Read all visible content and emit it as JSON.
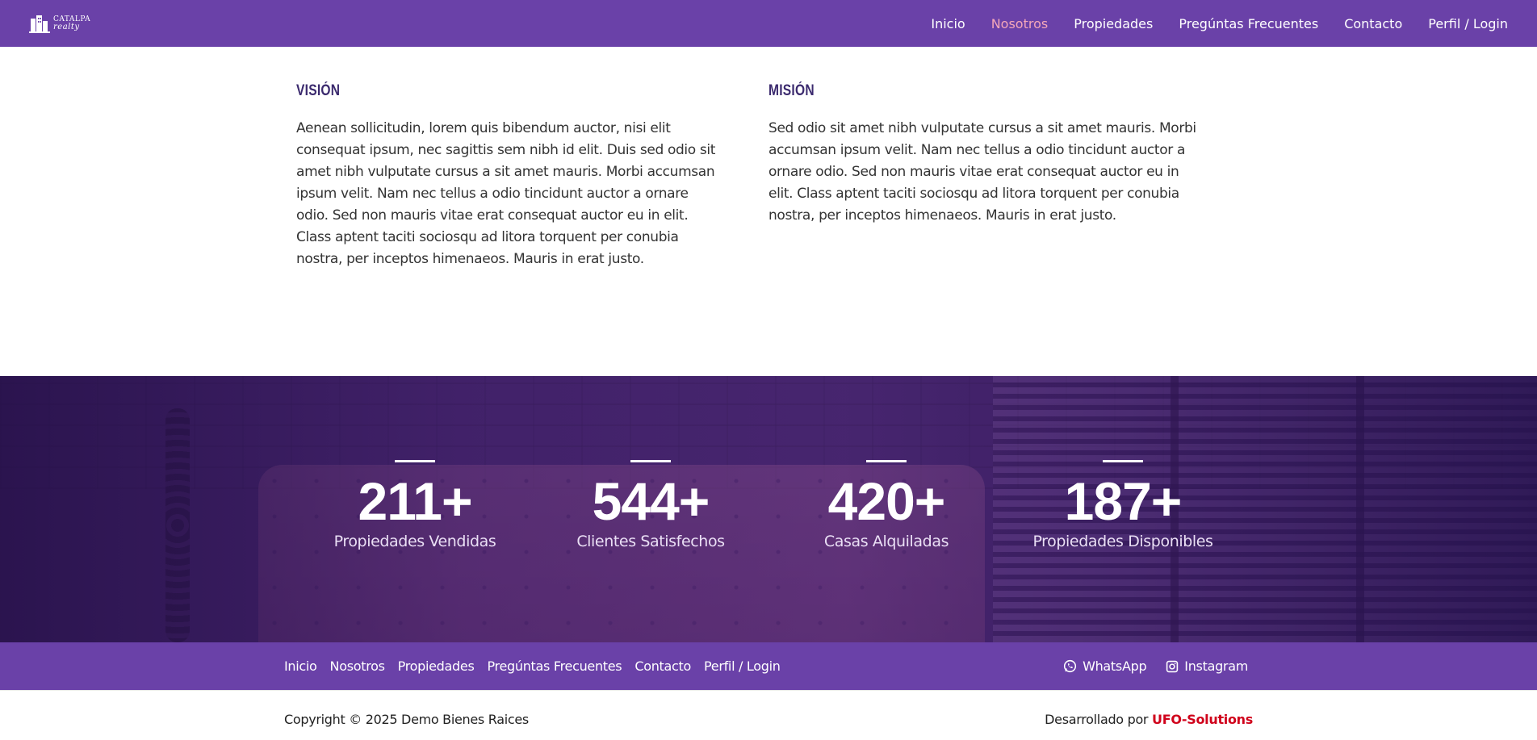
{
  "header": {
    "logo": {
      "line1": "CATALPA",
      "line2": "realty"
    },
    "nav": [
      {
        "label": "Inicio",
        "active": false
      },
      {
        "label": "Nosotros",
        "active": true
      },
      {
        "label": "Propiedades",
        "active": false
      },
      {
        "label": "Pregúntas Frecuentes",
        "active": false
      },
      {
        "label": "Contacto",
        "active": false
      },
      {
        "label": "Perfil / Login",
        "active": false
      }
    ]
  },
  "vision": {
    "title": "VISIÓN",
    "text": "Aenean sollicitudin, lorem quis bibendum auctor, nisi elit consequat ipsum, nec sagittis sem nibh id elit. Duis sed odio sit amet nibh vulputate cursus a sit amet mauris. Morbi accumsan ipsum velit. Nam nec tellus a odio tincidunt auctor a ornare odio. Sed non mauris vitae erat consequat auctor eu in elit. Class aptent taciti sociosqu ad litora torquent per conubia nostra, per inceptos himenaeos. Mauris in erat justo."
  },
  "mission": {
    "title": "MISIÓN",
    "text": "Sed odio sit amet nibh vulputate cursus a sit amet mauris. Morbi accumsan ipsum velit. Nam nec tellus a odio tincidunt auctor a ornare odio. Sed non mauris vitae erat consequat auctor eu in elit. Class aptent taciti sociosqu ad litora torquent per conubia nostra, per inceptos himenaeos. Mauris in erat justo."
  },
  "stats": [
    {
      "value": "211+",
      "label": "Propiedades Vendidas"
    },
    {
      "value": "544+",
      "label": "Clientes Satisfechos"
    },
    {
      "value": "420+",
      "label": "Casas Alquiladas"
    },
    {
      "value": "187+",
      "label": "Propiedades Disponibles"
    }
  ],
  "footer": {
    "nav": [
      {
        "label": "Inicio"
      },
      {
        "label": "Nosotros"
      },
      {
        "label": "Propiedades"
      },
      {
        "label": "Pregúntas Frecuentes"
      },
      {
        "label": "Contacto"
      },
      {
        "label": "Perfil / Login"
      }
    ],
    "social": {
      "whatsapp": {
        "label": "WhatsApp",
        "icon": "whatsapp-icon"
      },
      "instagram": {
        "label": "Instagram",
        "icon": "instagram-icon"
      }
    },
    "copyright": "Copyright © 2025 Demo Bienes Raices",
    "developed_prefix": "Desarrollado por ",
    "developer": "UFO-Solutions"
  },
  "colors": {
    "brand_purple": "#6a41a8",
    "active_link": "#f4a7b9",
    "heading": "#3b2a6e",
    "developer_red": "#d0021b"
  }
}
